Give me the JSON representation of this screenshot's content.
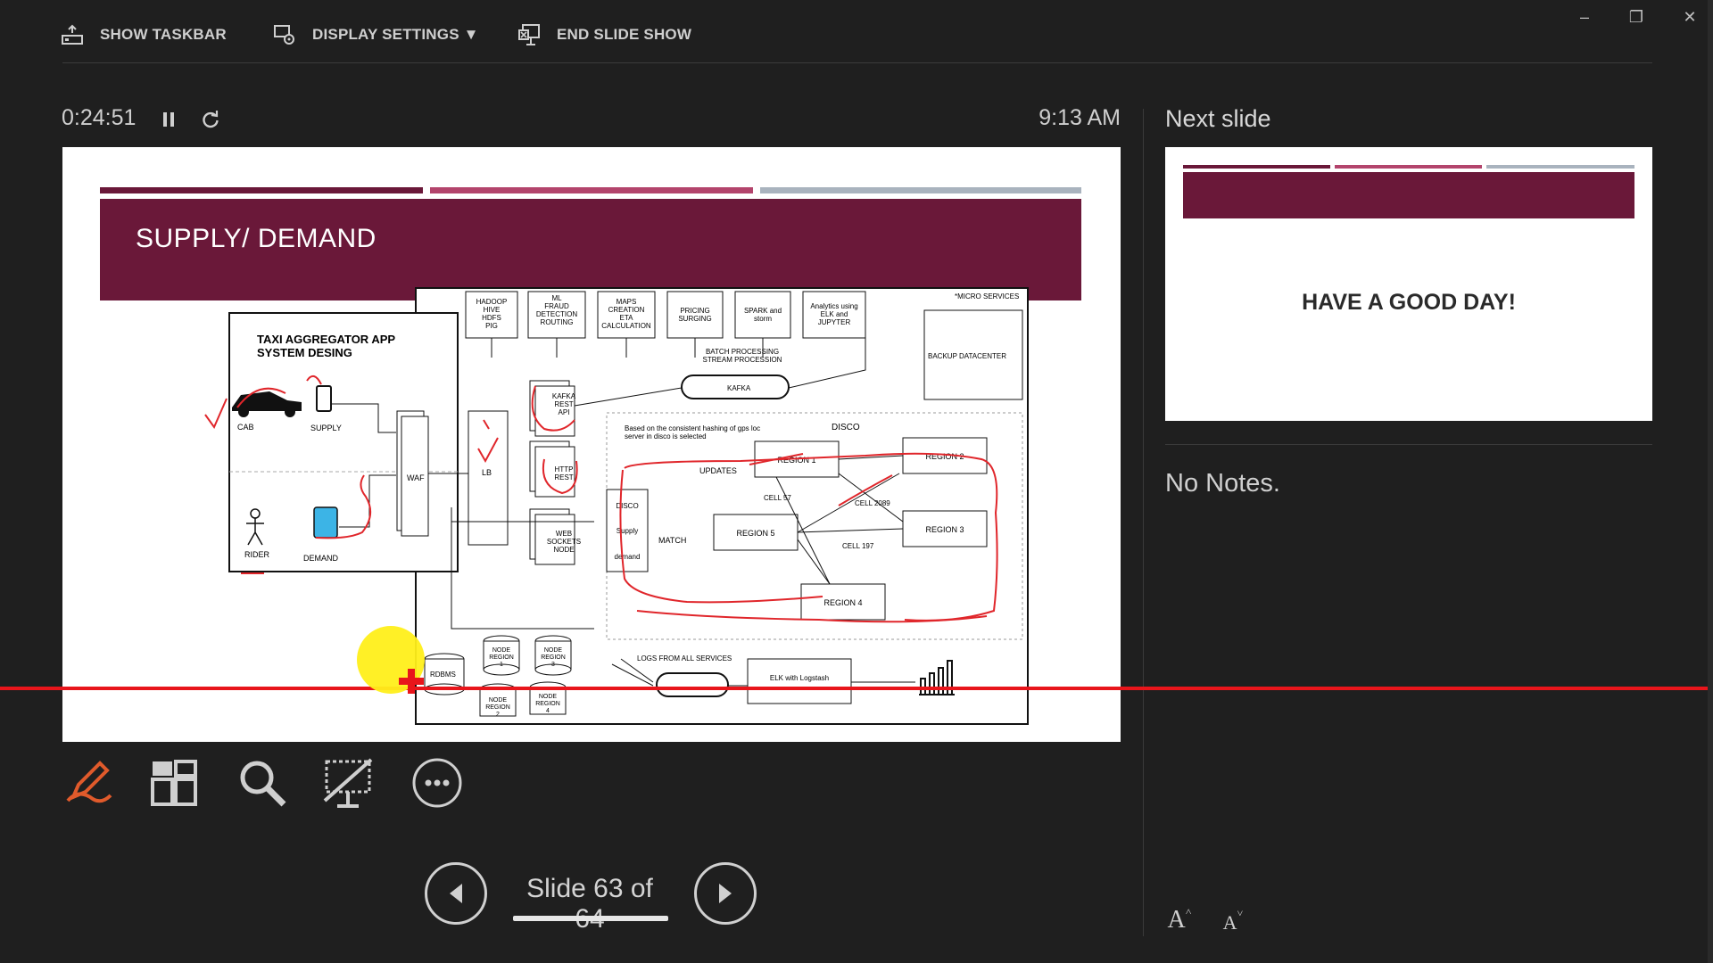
{
  "toolbar": {
    "show_taskbar": "SHOW TASKBAR",
    "display_settings": "DISPLAY SETTINGS ▼",
    "end_slide_show": "END SLIDE SHOW"
  },
  "window": {
    "minimize": "–",
    "restore": "❐",
    "close": "✕"
  },
  "presenter": {
    "elapsed": "0:24:51",
    "clock": "9:13 AM",
    "slide_counter": "Slide 63 of 64"
  },
  "current_slide": {
    "title": "SUPPLY/ DEMAND",
    "accent_colors": [
      "#6a1839",
      "#b3446c",
      "#a9b3be"
    ],
    "diagram": {
      "app_title": "TAXI AGGREGATOR APP",
      "app_subtitle": "SYSTEM DESING",
      "cab": "CAB",
      "supply": "SUPPLY",
      "rider": "RIDER",
      "demand": "DEMAND",
      "waf": "WAF",
      "lb": "LB",
      "micro_services": "*MICRO SERVICES",
      "backup_dc": "BACKUP DATACENTER",
      "svc_hadoop": [
        "HADOOP",
        "HIVE",
        "HDFS",
        "PIG"
      ],
      "svc_ml": [
        "ML",
        "FRAUD",
        "DETECTION",
        "ROUTING"
      ],
      "svc_maps": [
        "MAPS",
        "CREATION",
        "ETA",
        "CALCULATION"
      ],
      "svc_pricing": [
        "PRICING",
        "SURGING"
      ],
      "svc_spark": [
        "SPARK and",
        "storm"
      ],
      "svc_analytics": [
        "Analytics using",
        "ELK and",
        "JUPYTER"
      ],
      "batch": [
        "BATCH PROCESSING",
        "STREAM PROCESSION"
      ],
      "kafka": "KAFKA",
      "kafka_rest": [
        "KAFKA",
        "REST",
        "API"
      ],
      "http_rest": [
        "HTTP",
        "REST"
      ],
      "web_sockets": [
        "WEB",
        "SOCKETS",
        "NODE"
      ],
      "disco": "DISCO",
      "disco_note": [
        "Based on the  consistent hashing  of gps loc",
        "server in disco is selected"
      ],
      "disco_box": [
        "DISCO",
        "Supply",
        "demand"
      ],
      "updates": "UPDATES",
      "match": "MATCH",
      "region1": "REGION 1",
      "region2": "REGION 2",
      "region3": "REGION 3",
      "region4": "REGION 4",
      "region5": "REGION 5",
      "cell57": "CELL 57",
      "cell2089": "CELL 2089",
      "cell197": "CELL 197",
      "logs": "LOGS  FROM ALL SERVICES",
      "elk": "ELK with Logstash",
      "rdbms": "RDBMS",
      "node1": [
        "NODE",
        "REGION",
        "1"
      ],
      "node2": [
        "NODE",
        "REGION",
        "2"
      ],
      "node3": [
        "NODE",
        "REGION",
        "3"
      ],
      "node4": [
        "NODE",
        "REGION",
        "4"
      ]
    }
  },
  "tools": [
    "pen-tool",
    "see-all-slides",
    "zoom",
    "black-screen",
    "more-options"
  ],
  "next_slide": {
    "label": "Next slide",
    "text": "HAVE A GOOD DAY!"
  },
  "notes": {
    "text": "No Notes."
  },
  "font_size": {
    "increase": "A",
    "decrease": "A"
  },
  "colors": {
    "background": "#1f1f1f",
    "accent_maroon": "#6a1839",
    "pen_tool": "#e05a2b",
    "laser": "#e8151b",
    "highlighter": "#ffef1a"
  }
}
